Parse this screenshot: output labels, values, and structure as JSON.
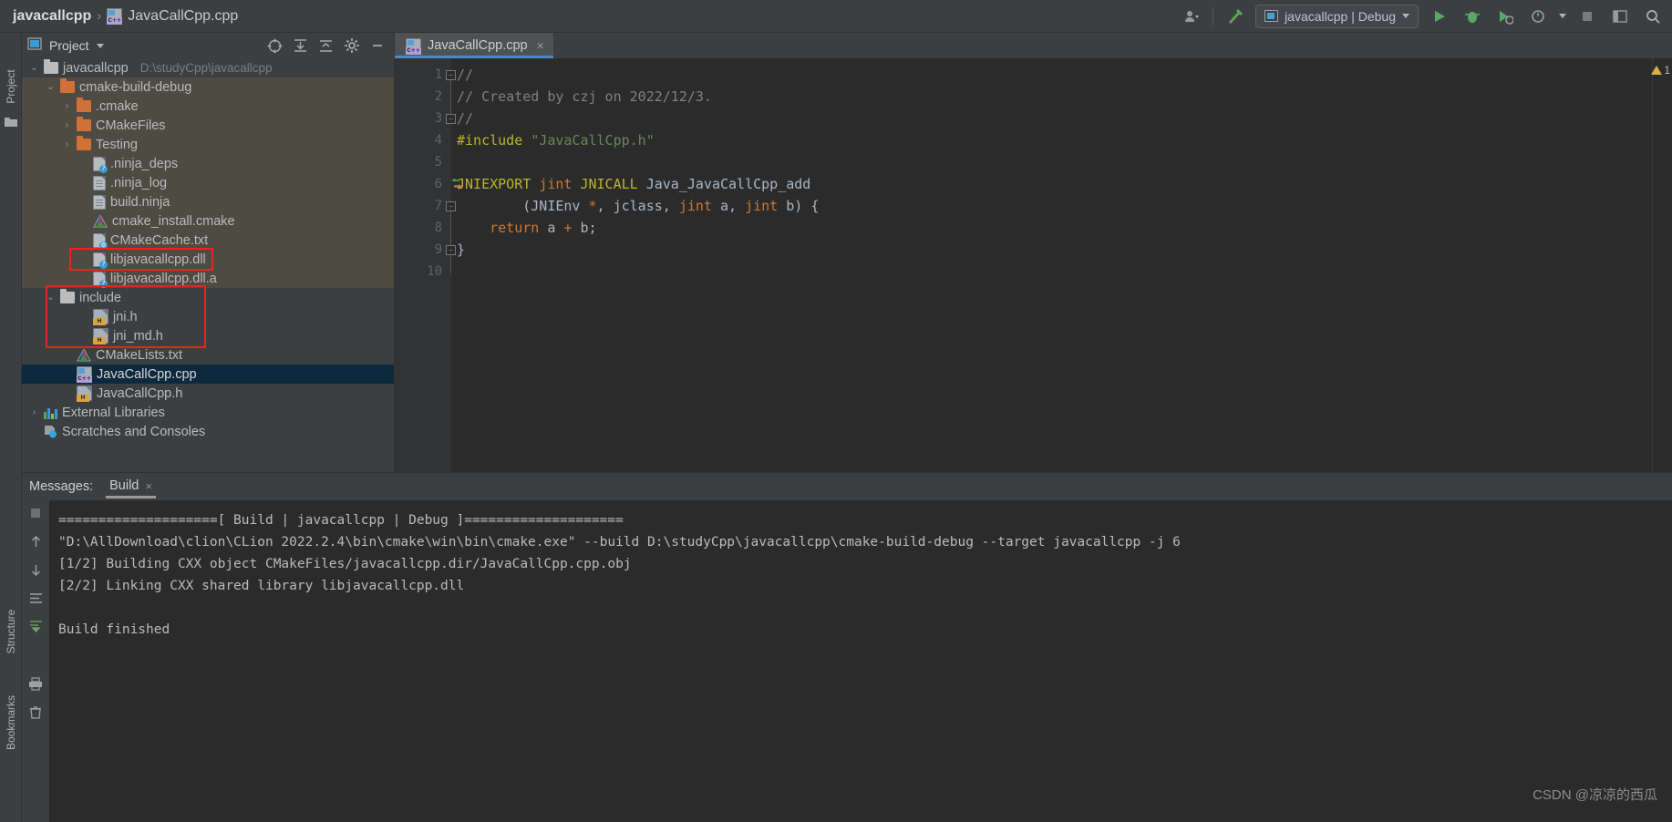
{
  "breadcrumb": {
    "project": "javacallcpp",
    "separator": "›",
    "file": "JavaCallCpp.cpp"
  },
  "toolbar": {
    "run_config": "javacallcpp | Debug",
    "icons": [
      "user-icon",
      "hammer-icon",
      "run-icon",
      "debug-icon",
      "attach-icon",
      "coverage-icon",
      "stop-icon",
      "layout-icon",
      "search-icon"
    ]
  },
  "left_strip": {
    "project_label": "Project",
    "structure_label": "Structure",
    "bookmarks_label": "Bookmarks"
  },
  "project_panel": {
    "title": "Project",
    "header_icons": [
      "target-icon",
      "expand-all-icon",
      "collapse-all-icon",
      "gear-icon",
      "minimize-icon"
    ],
    "tree": [
      {
        "indent": 0,
        "arrow": "⌄",
        "icon": "folder-grey",
        "label": "javacallcpp",
        "hint": "D:\\studyCpp\\javacallcpp",
        "bg": "none"
      },
      {
        "indent": 1,
        "arrow": "⌄",
        "icon": "folder-orange",
        "label": "cmake-build-debug",
        "hint": "",
        "bg": "build"
      },
      {
        "indent": 2,
        "arrow": "›",
        "icon": "folder-orange",
        "label": ".cmake",
        "hint": "",
        "bg": "build"
      },
      {
        "indent": 2,
        "arrow": "›",
        "icon": "folder-orange",
        "label": "CMakeFiles",
        "hint": "",
        "bg": "build"
      },
      {
        "indent": 2,
        "arrow": "›",
        "icon": "folder-orange",
        "label": "Testing",
        "hint": "",
        "bg": "build"
      },
      {
        "indent": 3,
        "arrow": "",
        "icon": "file-unknown",
        "label": ".ninja_deps",
        "hint": "",
        "bg": "build"
      },
      {
        "indent": 3,
        "arrow": "",
        "icon": "file-text",
        "label": ".ninja_log",
        "hint": "",
        "bg": "build"
      },
      {
        "indent": 3,
        "arrow": "",
        "icon": "file-text",
        "label": "build.ninja",
        "hint": "",
        "bg": "build"
      },
      {
        "indent": 3,
        "arrow": "",
        "icon": "cmake",
        "label": "cmake_install.cmake",
        "hint": "",
        "bg": "build"
      },
      {
        "indent": 3,
        "arrow": "",
        "icon": "file-gear",
        "label": "CMakeCache.txt",
        "hint": "",
        "bg": "build"
      },
      {
        "indent": 3,
        "arrow": "",
        "icon": "file-unknown",
        "label": "libjavacallcpp.dll",
        "hint": "",
        "bg": "build"
      },
      {
        "indent": 3,
        "arrow": "",
        "icon": "file-unknown",
        "label": "libjavacallcpp.dll.a",
        "hint": "",
        "bg": "build"
      },
      {
        "indent": 1,
        "arrow": "⌄",
        "icon": "folder-grey",
        "label": "include",
        "hint": "",
        "bg": "none"
      },
      {
        "indent": 3,
        "arrow": "",
        "icon": "header",
        "label": "jni.h",
        "hint": "",
        "bg": "none"
      },
      {
        "indent": 3,
        "arrow": "",
        "icon": "header",
        "label": "jni_md.h",
        "hint": "",
        "bg": "none"
      },
      {
        "indent": 2,
        "arrow": "",
        "icon": "cmake",
        "label": "CMakeLists.txt",
        "hint": "",
        "bg": "none"
      },
      {
        "indent": 2,
        "arrow": "",
        "icon": "cpp",
        "label": "JavaCallCpp.cpp",
        "hint": "",
        "bg": "selected"
      },
      {
        "indent": 2,
        "arrow": "",
        "icon": "header",
        "label": "JavaCallCpp.h",
        "hint": "",
        "bg": "none"
      },
      {
        "indent": 0,
        "arrow": "›",
        "icon": "library",
        "label": "External Libraries",
        "hint": "",
        "bg": "none"
      },
      {
        "indent": 0,
        "arrow": "",
        "icon": "scratch",
        "label": "Scratches and Consoles",
        "hint": "",
        "bg": "none"
      }
    ],
    "annotations": [
      {
        "name": "dll-highlight",
        "color": "#ef2020"
      },
      {
        "name": "include-highlight",
        "color": "#ef2020"
      }
    ]
  },
  "editor": {
    "tab": {
      "label": "JavaCallCpp.cpp",
      "close": "×"
    },
    "lines": [
      {
        "n": "1",
        "text": "//"
      },
      {
        "n": "2",
        "text": "// Created by czj on 2022/12/3."
      },
      {
        "n": "3",
        "text": "//"
      },
      {
        "n": "4",
        "text": "#include \"JavaCallCpp.h\""
      },
      {
        "n": "5",
        "text": ""
      },
      {
        "n": "6",
        "text": "JNIEXPORT jint JNICALL Java_JavaCallCpp_add"
      },
      {
        "n": "7",
        "text": "        (JNIEnv *, jclass, jint a, jint b) {"
      },
      {
        "n": "8",
        "text": "    return a + b;"
      },
      {
        "n": "9",
        "text": "}"
      },
      {
        "n": "10",
        "text": ""
      }
    ],
    "warning_count": "1"
  },
  "bottom": {
    "messages_label": "Messages:",
    "build_tab": "Build",
    "close": "×",
    "console_lines": [
      "====================[ Build | javacallcpp | Debug ]====================",
      "\"D:\\AllDownload\\clion\\CLion 2022.2.4\\bin\\cmake\\win\\bin\\cmake.exe\" --build D:\\studyCpp\\javacallcpp\\cmake-build-debug --target javacallcpp -j 6",
      "[1/2] Building CXX object CMakeFiles/javacallcpp.dir/JavaCallCpp.cpp.obj",
      "[2/2] Linking CXX shared library libjavacallcpp.dll",
      "",
      "Build finished"
    ],
    "strip_icons": [
      "rerun-icon",
      "up-icon",
      "down-icon",
      "wrap-icon",
      "scroll-end-icon",
      "print-icon",
      "trash-icon"
    ]
  },
  "watermark": "CSDN @凉凉的西瓜",
  "colors": {
    "accent": "#4a88c7",
    "selection": "#0d293e",
    "build_folder_bg": "#4e4b42",
    "annotation": "#ef2020",
    "editor_bg": "#2b2b2b",
    "panel_bg": "#3c3f41"
  }
}
